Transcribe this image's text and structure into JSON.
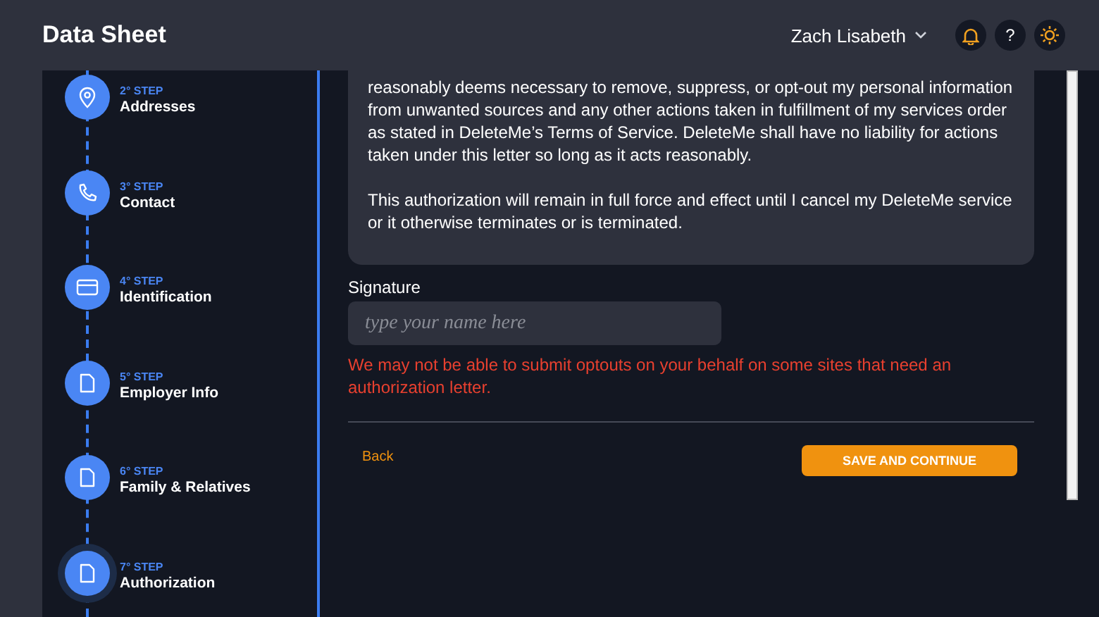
{
  "header": {
    "title": "Data Sheet",
    "user": "Zach Lisabeth",
    "help": "?"
  },
  "steps": [
    {
      "number": "2° STEP",
      "label": "Addresses",
      "kind": "pin",
      "selected": false
    },
    {
      "number": "3° STEP",
      "label": "Contact",
      "kind": "phone",
      "selected": false
    },
    {
      "number": "4° STEP",
      "label": "Identification",
      "kind": "card",
      "selected": false
    },
    {
      "number": "5° STEP",
      "label": "Employer Info",
      "kind": "doc",
      "selected": false
    },
    {
      "number": "6° STEP",
      "label": "Family & Relatives",
      "kind": "doc",
      "selected": false
    },
    {
      "number": "7° STEP",
      "label": "Authorization",
      "kind": "doc",
      "selected": true
    }
  ],
  "letter": [
    "reasonably deems necessary to remove, suppress, or opt-out my personal information from unwanted sources and any other actions taken in fulfillment of my services order as stated in DeleteMe’s Terms of Service. DeleteMe shall have no liability for actions taken under this letter so long as it acts reasonably.",
    "This authorization will remain in full force and effect until I cancel my DeleteMe service or it otherwise terminates or is terminated."
  ],
  "signature": {
    "label": "Signature",
    "placeholder": "type your name here"
  },
  "warning": "We may not be able to submit optouts on your behalf on some sites that need an authorization letter.",
  "back": "Back",
  "submit": "SAVE AND CONTINUE"
}
